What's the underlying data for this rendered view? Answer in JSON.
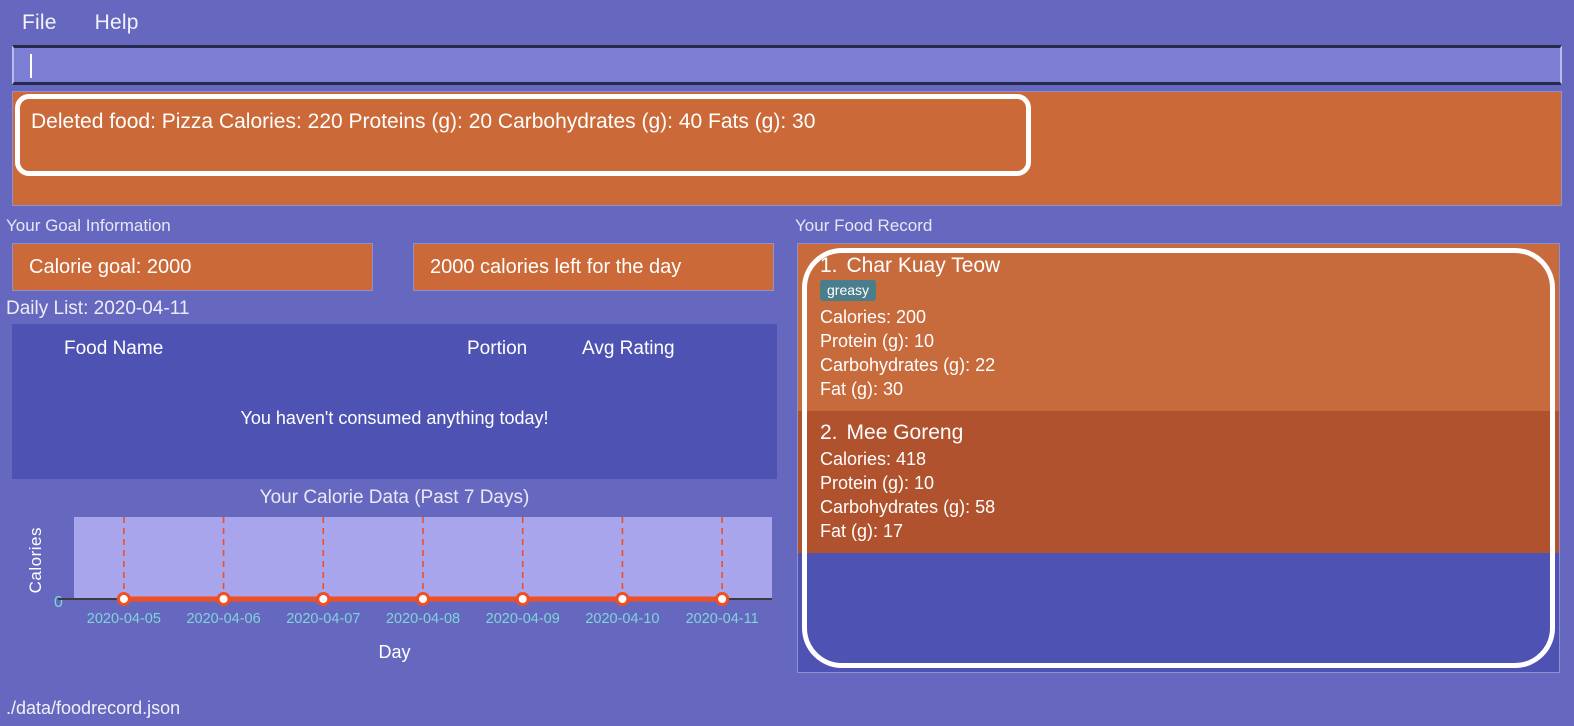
{
  "menubar": {
    "items": [
      {
        "label": "File"
      },
      {
        "label": "Help"
      }
    ]
  },
  "search": {
    "value": "",
    "placeholder": ""
  },
  "alert": {
    "message": "Deleted food: Pizza Calories: 220 Proteins (g): 20 Carbohydrates (g): 40 Fats (g): 30",
    "background_color": "#cb6a38",
    "focused": "true"
  },
  "goal": {
    "section_label": "Your Goal Information",
    "calorie_goal_label": "Calorie goal: 2000",
    "calories_left_label": "2000 calories left for the day"
  },
  "daily_list": {
    "heading": "Daily List: 2020-04-11",
    "columns": [
      "Food Name",
      "Portion",
      "Avg Rating"
    ],
    "rows": [],
    "empty_message": "You haven't consumed anything today!"
  },
  "chart_data": {
    "type": "line",
    "title": "Your Calorie Data (Past 7 Days)",
    "xlabel": "Day",
    "ylabel": "Calories",
    "categories": [
      "2020-04-05",
      "2020-04-06",
      "2020-04-07",
      "2020-04-08",
      "2020-04-09",
      "2020-04-10",
      "2020-04-11"
    ],
    "values": [
      0,
      0,
      0,
      0,
      0,
      0,
      0
    ],
    "yticks": [
      "0"
    ],
    "ylim": [
      0,
      1
    ],
    "grid": "vertical-dashed",
    "legend": "none",
    "line_color": "#f04e23",
    "marker_face_color": "#ffffff",
    "marker_edge_color": "#f04e23",
    "plot_background": "#a8a5ec",
    "tick_label_color": "#7fd4d8"
  },
  "food_record": {
    "section_label": "Your Food Record",
    "focused": "true",
    "items": [
      {
        "number": "1.",
        "name": "Char Kuay Teow",
        "tags": [
          "greasy"
        ],
        "calories": "Calories: 200",
        "protein": "Protein (g): 10",
        "carbohydrates": "Carbohydrates (g): 22",
        "fat": "Fat (g): 30"
      },
      {
        "number": "2.",
        "name": "Mee Goreng",
        "tags": [],
        "calories": "Calories: 418",
        "protein": "Protein (g): 10",
        "carbohydrates": "Carbohydrates (g): 58",
        "fat": "Fat (g): 17"
      }
    ]
  },
  "statusbar": {
    "path": "./data/foodrecord.json"
  },
  "colors": {
    "window_background": "#6668c0",
    "panel_background": "#4d52b3",
    "accent_orange": "#cb6a38",
    "accent_orange_dark": "#b0522e",
    "tag_teal": "#4a7e8c",
    "focus_ring": "#ffffff"
  }
}
